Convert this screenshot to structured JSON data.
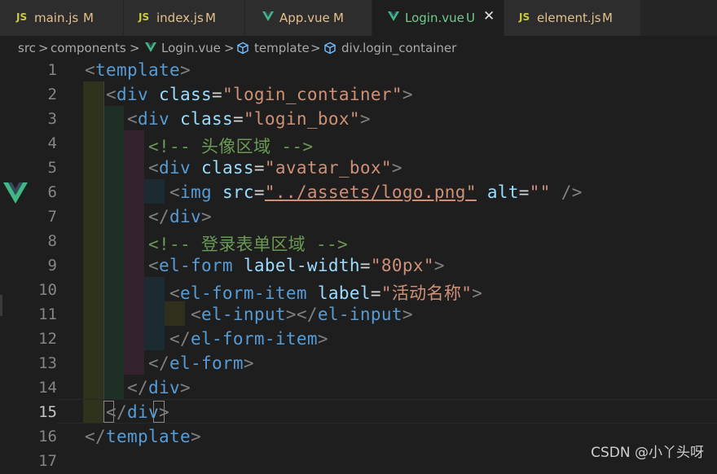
{
  "tabs": [
    {
      "icon": "JS",
      "label": "main.js",
      "badge": "M",
      "type": "js"
    },
    {
      "icon": "JS",
      "label": "index.js",
      "badge": "M",
      "type": "js"
    },
    {
      "icon": "V",
      "label": "App.vue",
      "badge": "M",
      "type": "vue"
    },
    {
      "icon": "V",
      "label": "Login.vue",
      "badge": "U",
      "type": "vue",
      "active": true,
      "close": "✕"
    },
    {
      "icon": "JS",
      "label": "element.js",
      "badge": "M",
      "type": "js"
    }
  ],
  "breadcrumb": {
    "folder1": "src",
    "folder2": "components",
    "file": "Login.vue",
    "node1": "template",
    "node2": "div.login_container",
    "sep": ">"
  },
  "code_lines": [
    {
      "n": "1"
    },
    {
      "n": "2"
    },
    {
      "n": "3"
    },
    {
      "n": "4"
    },
    {
      "n": "5"
    },
    {
      "n": "6"
    },
    {
      "n": "7"
    },
    {
      "n": "8"
    },
    {
      "n": "9"
    },
    {
      "n": "10"
    },
    {
      "n": "11"
    },
    {
      "n": "12"
    },
    {
      "n": "13"
    },
    {
      "n": "14"
    },
    {
      "n": "15"
    },
    {
      "n": "16"
    },
    {
      "n": "17"
    }
  ],
  "code": {
    "l1_tag": "template",
    "l2_tag": "div",
    "l2_attr": "class",
    "l2_val": "\"login_container\"",
    "l3_tag": "div",
    "l3_attr": "class",
    "l3_val": "\"login_box\"",
    "l4_cmt": "<!-- 头像区域 -->",
    "l5_tag": "div",
    "l5_attr": "class",
    "l5_val": "\"avatar_box\"",
    "l6_tag": "img",
    "l6_attr1": "src",
    "l6_q1": "\"",
    "l6_path": "../assets/logo.png",
    "l6_q2": "\"",
    "l6_attr2": "alt",
    "l6_val2": "\"\"",
    "l7_tag": "div",
    "l8_cmt": "<!-- 登录表单区域 -->",
    "l9_tag": "el-form",
    "l9_attr": "label-width",
    "l9_val": "\"80px\"",
    "l10_tag": "el-form-item",
    "l10_attr": "label",
    "l10_val": "\"活动名称\"",
    "l11_tag1": "el-input",
    "l11_tag2": "el-input",
    "l12_tag": "el-form-item",
    "l13_tag": "el-form",
    "l14_tag": "div",
    "l15_tag": "div",
    "l16_tag": "template"
  },
  "watermark": "CSDN @小丫头呀",
  "colors": {
    "tag": "#569cd6",
    "attr": "#9cdcfe",
    "string": "#ce9178",
    "comment": "#6a9955",
    "vue": "#41b883",
    "js": "#cbcb41",
    "modified": "#e2c08d",
    "untracked": "#73c991"
  }
}
